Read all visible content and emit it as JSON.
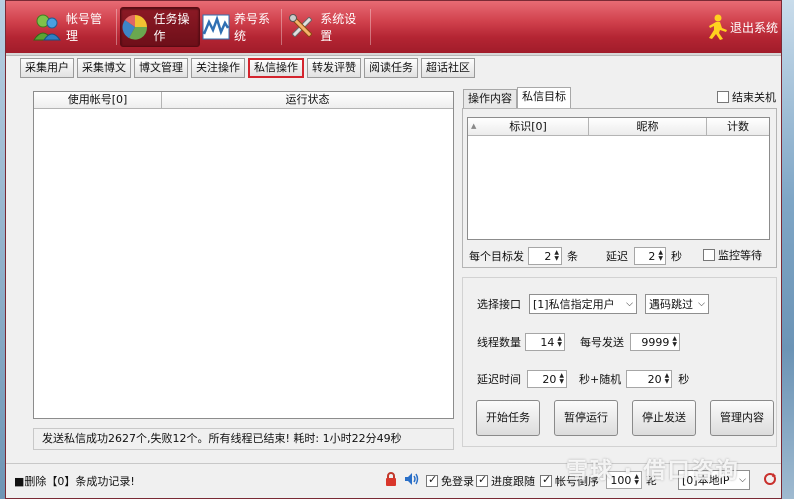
{
  "header": {
    "nav": [
      {
        "label": "帐号管理",
        "icon": "people-icon"
      },
      {
        "label": "任务操作",
        "icon": "pie-chart-icon"
      },
      {
        "label": "养号系统",
        "icon": "wave-chart-icon"
      },
      {
        "label": "系统设置",
        "icon": "tools-icon"
      }
    ],
    "logout": {
      "label": "退出系统",
      "icon": "running-man-icon"
    }
  },
  "toolbar": [
    "采集用户",
    "采集博文",
    "博文管理",
    "关注操作",
    "私信操作",
    "转发评赞",
    "阅读任务",
    "超话社区"
  ],
  "left_table": {
    "columns": [
      "使用帐号[0]",
      "运行状态"
    ]
  },
  "status_message": "发送私信成功2627个,失败12个。所有线程已结束! 耗时: 1小时22分49秒",
  "right_tabs": [
    "操作内容",
    "私信目标"
  ],
  "shutdown_label": "结束关机",
  "target_table": {
    "columns": [
      "标识[0]",
      "昵称",
      "计数"
    ]
  },
  "per_target": {
    "label": "每个目标发",
    "value": "2",
    "unit": "条"
  },
  "delay": {
    "label": "延迟",
    "value": "2",
    "unit": "秒"
  },
  "monitor_wait": "监控等待",
  "interface": {
    "label": "选择接口",
    "value": "[1]私信指定用户"
  },
  "captcha": {
    "value": "遇码跳过"
  },
  "threads": {
    "label": "线程数量",
    "value": "14"
  },
  "per_account": {
    "label": "每号发送",
    "value": "9999"
  },
  "delay_time": {
    "label": "延迟时间",
    "value": "20",
    "mid": "秒+随机",
    "value2": "20",
    "unit": "秒"
  },
  "buttons": [
    "开始任务",
    "暂停运行",
    "停止发送",
    "管理内容"
  ],
  "statusbar": {
    "message": "■删除【0】条成功记录!",
    "checks": [
      {
        "label": "免登录",
        "checked": true
      },
      {
        "label": "进度跟随",
        "checked": true
      },
      {
        "label": "帐号倒序",
        "checked": true
      }
    ],
    "rounds_value": "100",
    "rounds_unit": "轮",
    "ip_label": "[0]本地IP"
  },
  "watermark": "雪球 · 借口咨询"
}
